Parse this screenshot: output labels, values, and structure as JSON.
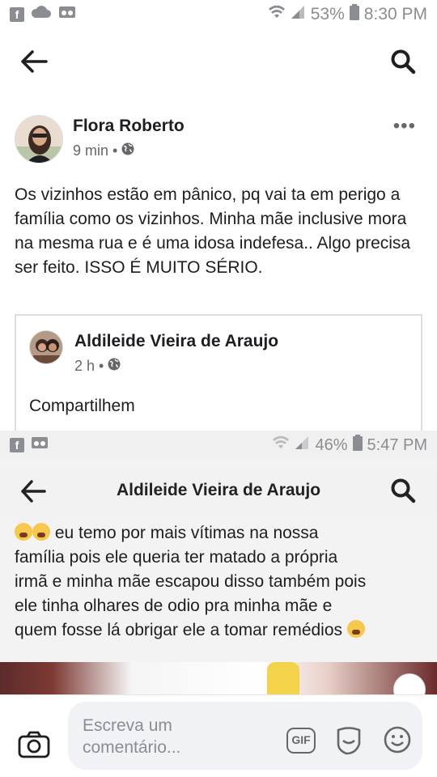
{
  "status_bar": {
    "battery": "53%",
    "time": "8:30 PM"
  },
  "post": {
    "author": "Flora Roberto",
    "time": "9 min",
    "dot": "•",
    "more": "•••",
    "text": "Os vizinhos estão em pânico, pq vai ta em perigo a família como os vizinhos. Minha mãe inclusive mora na mesma rua e é uma idosa indefesa.. Algo precisa ser feito. ISSO É MUITO SÉRIO."
  },
  "shared_post": {
    "author": "Aldileide Vieira de Araujo",
    "time": "2 h",
    "dot": "•",
    "text": "Compartilhem"
  },
  "embedded_screenshot": {
    "status_bar": {
      "battery": "46%",
      "time": "5:47 PM"
    },
    "title": "Aldileide Vieira de Araujo",
    "message_lines": [
      "eu temo por mais vítimas na nossa",
      "família pois ele queria ter matado a própria",
      "irmã e minha mãe escapou disso também pois",
      "ele tinha olhares de odio pra minha mãe e",
      "quem fosse lá obrigar ele a tomar remédios"
    ]
  },
  "composer": {
    "placeholder_line1": "Escreva um",
    "placeholder_line2": "comentário...",
    "gif_label": "GIF"
  }
}
